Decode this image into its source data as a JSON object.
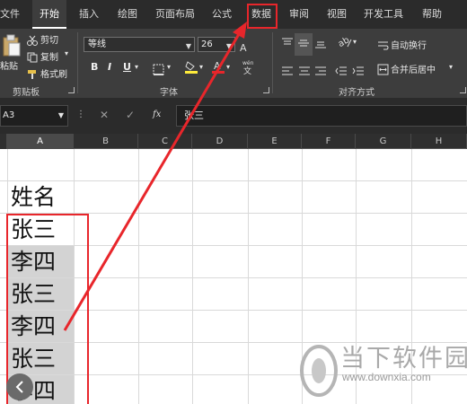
{
  "tabs": {
    "file": "文件",
    "home": "开始",
    "insert": "插入",
    "draw": "绘图",
    "layout": "页面布局",
    "formula": "公式",
    "data": "数据",
    "review": "审阅",
    "view": "视图",
    "dev": "开发工具",
    "help": "帮助"
  },
  "ribbon": {
    "paste": "粘贴",
    "cut": "剪切",
    "copy": "复制",
    "format_painter": "格式刷",
    "clipboard_label": "剪贴板",
    "font_name": "等线",
    "font_size": "26",
    "bold": "B",
    "italic": "I",
    "underline": "U",
    "font_label": "字体",
    "wrap_text": "自动换行",
    "merge_center": "合并后居中",
    "align_label": "对齐方式"
  },
  "formula_bar": {
    "name_box": "A3",
    "content": "张三",
    "fx": "fx"
  },
  "columns": [
    "A",
    "B",
    "C",
    "D",
    "E",
    "F",
    "G",
    "H"
  ],
  "cells": {
    "header": "姓名",
    "rows": [
      "张三",
      "李四",
      "张三",
      "李四",
      "张三",
      "李四"
    ]
  },
  "watermark": {
    "brand": "当下软件园",
    "url": "www.downxia.com"
  },
  "colors": {
    "highlight": "#e8262b",
    "selection": "#d3d3d3",
    "ribbon": "#3d3d3d"
  }
}
